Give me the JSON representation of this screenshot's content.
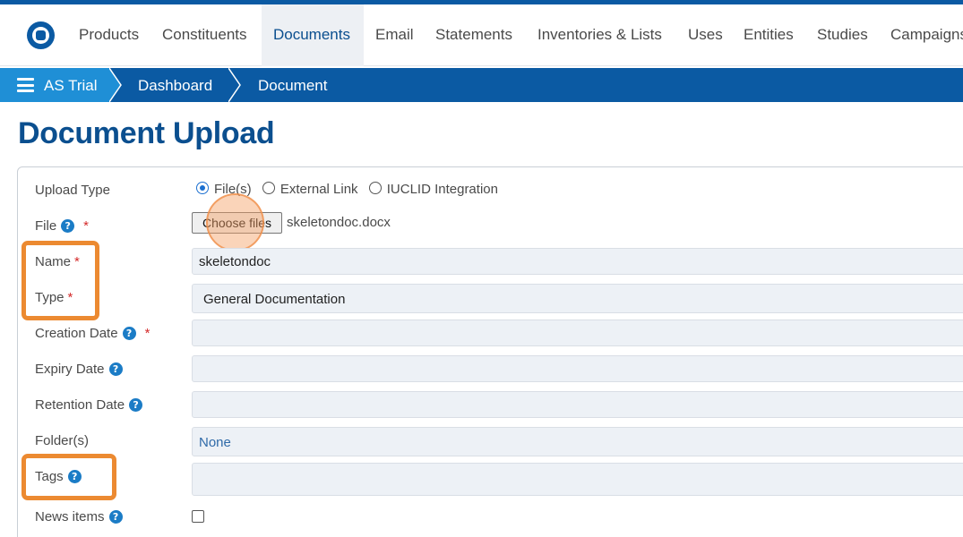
{
  "nav": {
    "items": [
      "Products",
      "Constituents",
      "Documents",
      "Email",
      "Statements",
      "Inventories & Lists",
      "Uses",
      "Entities",
      "Studies",
      "Campaigns"
    ],
    "active": "Documents"
  },
  "breadcrumb": [
    "AS Trial",
    "Dashboard",
    "Document"
  ],
  "page": {
    "title": "Document Upload"
  },
  "form": {
    "upload_type": {
      "label": "Upload Type",
      "options": [
        "File(s)",
        "External Link",
        "IUCLID Integration"
      ],
      "selected": "File(s)"
    },
    "file": {
      "label": "File",
      "button": "Choose files",
      "filename": "skeletondoc.docx"
    },
    "name": {
      "label": "Name",
      "value": "skeletondoc"
    },
    "type": {
      "label": "Type",
      "value": "General Documentation"
    },
    "creation_date": {
      "label": "Creation Date",
      "value": ""
    },
    "expiry_date": {
      "label": "Expiry Date",
      "value": ""
    },
    "retention_date": {
      "label": "Retention Date",
      "value": ""
    },
    "folders": {
      "label": "Folder(s)",
      "value": "None"
    },
    "tags": {
      "label": "Tags",
      "value": ""
    },
    "news_items": {
      "label": "News items",
      "checked": false
    },
    "required_mark": "*",
    "help_glyph": "?"
  },
  "colors": {
    "brand_blue": "#0b5aa3",
    "breadcrumb_first": "#1f8fd6",
    "title": "#0b4f8f",
    "highlight": "#ec8a31",
    "required": "#d42a2a"
  }
}
